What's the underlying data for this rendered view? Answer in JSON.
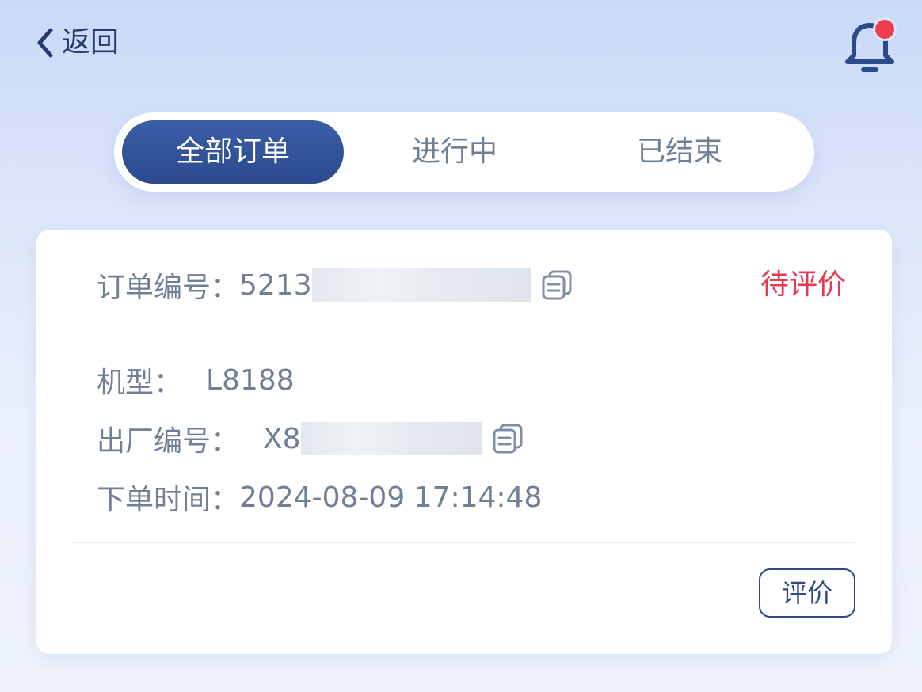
{
  "header": {
    "back_label": "返回"
  },
  "tabs": [
    {
      "label": "全部订单",
      "active": true
    },
    {
      "label": "进行中",
      "active": false
    },
    {
      "label": "已结束",
      "active": false
    }
  ],
  "order": {
    "number_label": "订单编号：",
    "number_value": "5213",
    "status": "待评价",
    "model_label": "机型：",
    "model_value": "L8188",
    "serial_label": "出厂编号：",
    "serial_value": "X8",
    "time_label": "下单时间：",
    "time_value": "2024-08-09 17:14:48",
    "review_button": "评价"
  },
  "colors": {
    "accent": "#2c4a8f",
    "status_red": "#e23a52",
    "notification_dot": "#ef3d4f"
  },
  "icons": [
    "chevron-left-icon",
    "bell-icon",
    "copy-icon"
  ]
}
